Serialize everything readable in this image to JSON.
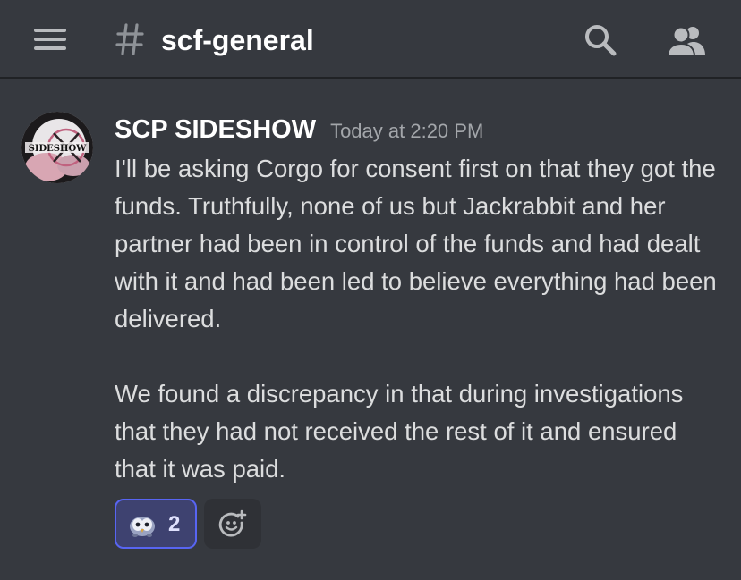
{
  "header": {
    "menu_icon": "hamburger-menu-icon",
    "channel_icon": "hash-icon",
    "channel_name": "scf-general",
    "search_icon": "search-icon",
    "members_icon": "members-icon"
  },
  "message": {
    "author": "SCP SIDESHOW",
    "timestamp": "Today at 2:20 PM",
    "avatar_text": "SIDESHOW",
    "paragraphs": [
      "I'll be asking Corgo for consent first on that they got the funds. Truthfully, none of us but Jackrabbit and her partner had been in control of the funds and had dealt with it and had been led to believe everything had been delivered.",
      "We found a discrepancy in that during investigations that they had not received the rest of it and ensured that it was paid."
    ],
    "reactions": [
      {
        "emoji": "parrot-emoji",
        "count": "2",
        "selected": true
      }
    ],
    "add_reaction_icon": "add-reaction-icon"
  },
  "colors": {
    "background": "#36393f",
    "header_border": "#202225",
    "text": "#dcddde",
    "author": "#ffffff",
    "timestamp": "#a3a6aa",
    "accent": "#5865f2",
    "reaction_selected_bg": "#3e4270",
    "add_reaction_bg": "#2f3136"
  }
}
